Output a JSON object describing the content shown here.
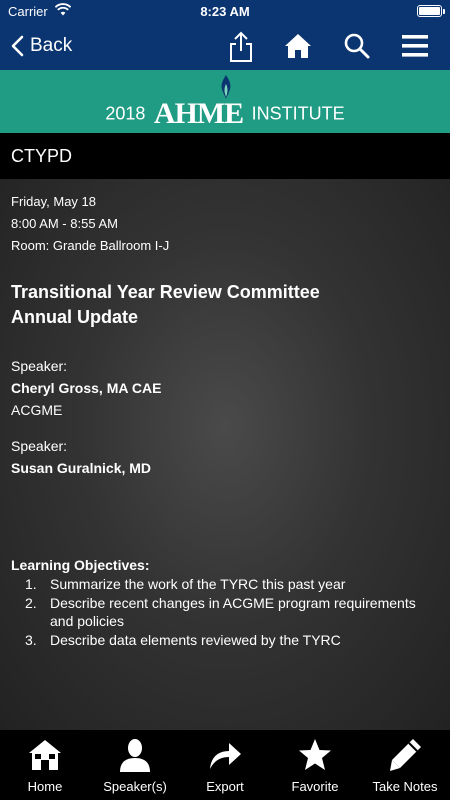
{
  "status_bar": {
    "carrier": "Carrier",
    "time": "8:23 AM"
  },
  "nav": {
    "back_label": "Back"
  },
  "banner": {
    "year": "2018",
    "brand": "AHME",
    "suffix": "INSTITUTE"
  },
  "section": {
    "header": "CTYPD"
  },
  "session": {
    "date": "Friday, May 18",
    "time": "8:00 AM - 8:55 AM",
    "room": "Room: Grande Ballroom I-J",
    "title": "Transitional Year Review Committee Annual Update"
  },
  "speakers": [
    {
      "label": "Speaker:",
      "name": "Cheryl Gross, MA CAE",
      "org": "ACGME"
    },
    {
      "label": "Speaker:",
      "name": "Susan Guralnick, MD",
      "org": ""
    }
  ],
  "objectives": {
    "title": "Learning Objectives:",
    "items": [
      {
        "num": "1.",
        "text": "Summarize the work of the TYRC this past year"
      },
      {
        "num": "2.",
        "text": "Describe recent changes in ACGME program requirements and policies"
      },
      {
        "num": "3.",
        "text": "Describe data elements reviewed by the TYRC"
      }
    ]
  },
  "tabs": [
    {
      "label": "Home",
      "icon": "home-icon"
    },
    {
      "label": "Speaker(s)",
      "icon": "person-icon"
    },
    {
      "label": "Export",
      "icon": "export-arrow-icon"
    },
    {
      "label": "Favorite",
      "icon": "star-icon"
    },
    {
      "label": "Take Notes",
      "icon": "pencil-icon"
    }
  ],
  "colors": {
    "nav": "#0b3570",
    "banner": "#1f9c83",
    "header": "#000000"
  }
}
